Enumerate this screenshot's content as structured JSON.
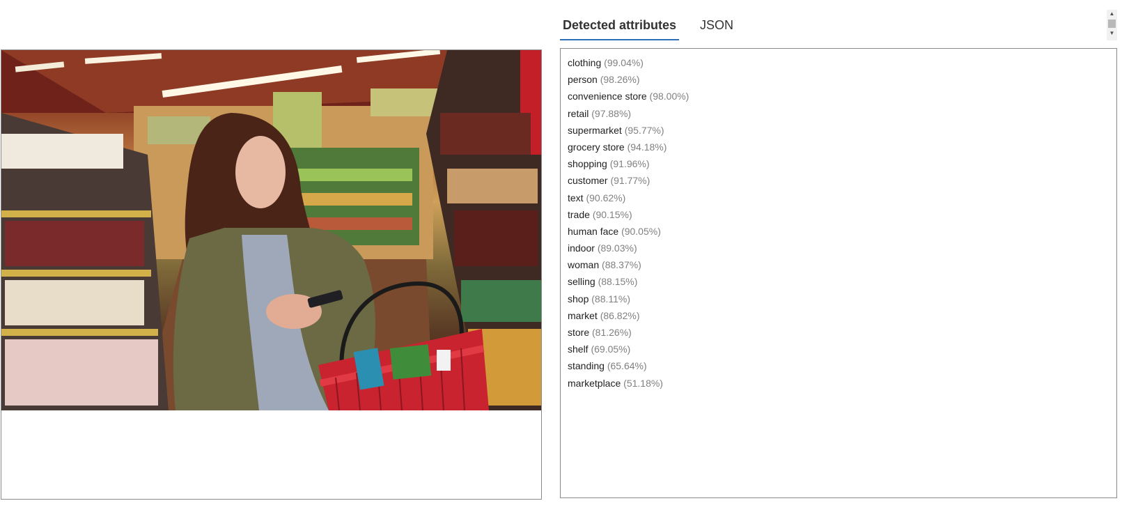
{
  "tabs": [
    {
      "label": "Detected attributes",
      "active": true
    },
    {
      "label": "JSON",
      "active": false
    }
  ],
  "attributes": [
    {
      "name": "clothing",
      "confidence": "(99.04%)"
    },
    {
      "name": "person",
      "confidence": "(98.26%)"
    },
    {
      "name": "convenience store",
      "confidence": "(98.00%)"
    },
    {
      "name": "retail",
      "confidence": "(97.88%)"
    },
    {
      "name": "supermarket",
      "confidence": "(95.77%)"
    },
    {
      "name": "grocery store",
      "confidence": "(94.18%)"
    },
    {
      "name": "shopping",
      "confidence": "(91.96%)"
    },
    {
      "name": "customer",
      "confidence": "(91.77%)"
    },
    {
      "name": "text",
      "confidence": "(90.62%)"
    },
    {
      "name": "trade",
      "confidence": "(90.15%)"
    },
    {
      "name": "human face",
      "confidence": "(90.05%)"
    },
    {
      "name": "indoor",
      "confidence": "(89.03%)"
    },
    {
      "name": "woman",
      "confidence": "(88.37%)"
    },
    {
      "name": "selling",
      "confidence": "(88.15%)"
    },
    {
      "name": "shop",
      "confidence": "(88.11%)"
    },
    {
      "name": "market",
      "confidence": "(86.82%)"
    },
    {
      "name": "store",
      "confidence": "(81.26%)"
    },
    {
      "name": "shelf",
      "confidence": "(69.05%)"
    },
    {
      "name": "standing",
      "confidence": "(65.64%)"
    },
    {
      "name": "marketplace",
      "confidence": "(51.18%)"
    }
  ],
  "icons": {
    "scroll_up": "scroll-up-arrow-icon",
    "scroll_down": "scroll-down-arrow-icon"
  },
  "colors": {
    "active_tab_underline": "#2c6fb7",
    "confidence_text": "#808080"
  }
}
